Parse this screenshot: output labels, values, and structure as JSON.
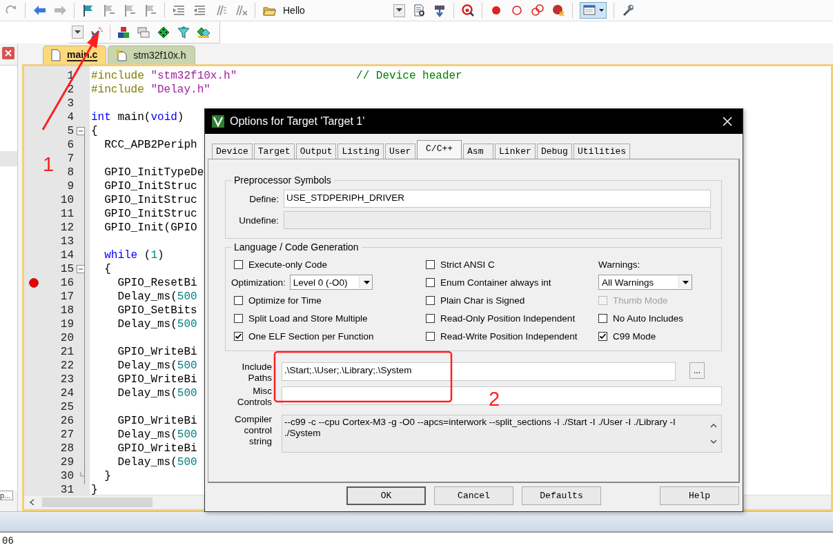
{
  "toolbar": {
    "target_name": "Hello"
  },
  "side_panel": {
    "truncated_label": "p..."
  },
  "editor": {
    "tabs": [
      {
        "label": "main.c",
        "selected": true,
        "kind": "source"
      },
      {
        "label": "stm32f10x.h",
        "selected": false,
        "kind": "header"
      }
    ],
    "lines": [
      {
        "number": "1",
        "breakpoint": false,
        "tokens": [
          {
            "kind": "preproc",
            "text": "#include"
          },
          {
            "kind": "string",
            "text": " \"stm32f10x.h\""
          },
          {
            "kind": "comment",
            "text": "                  // Device header"
          }
        ]
      },
      {
        "number": "2",
        "breakpoint": false,
        "tokens": [
          {
            "kind": "preproc",
            "text": "#include"
          },
          {
            "kind": "string",
            "text": " \"Delay.h\""
          }
        ]
      },
      {
        "number": "3",
        "breakpoint": false
      },
      {
        "number": "4",
        "breakpoint": false,
        "tokens": [
          {
            "kind": "keyword",
            "text": "int"
          },
          {
            "kind": "plain",
            "text": " main("
          },
          {
            "kind": "keyword",
            "text": "void"
          },
          {
            "kind": "plain",
            "text": ")"
          }
        ]
      },
      {
        "number": "5",
        "breakpoint": false,
        "kind": "fold",
        "tokens": [
          {
            "kind": "plain",
            "text": "{"
          }
        ]
      },
      {
        "number": "6",
        "breakpoint": false,
        "tokens": [
          {
            "kind": "plain",
            "text": "  RCC_APB2Periph"
          }
        ]
      },
      {
        "number": "7",
        "breakpoint": false
      },
      {
        "number": "8",
        "breakpoint": false,
        "tokens": [
          {
            "kind": "plain",
            "text": "  GPIO_InitTypeDe"
          }
        ]
      },
      {
        "number": "9",
        "breakpoint": false,
        "tokens": [
          {
            "kind": "plain",
            "text": "  GPIO_InitStruc"
          }
        ]
      },
      {
        "number": "10",
        "breakpoint": false,
        "tokens": [
          {
            "kind": "plain",
            "text": "  GPIO_InitStruc"
          }
        ]
      },
      {
        "number": "11",
        "breakpoint": false,
        "tokens": [
          {
            "kind": "plain",
            "text": "  GPIO_InitStruc"
          }
        ]
      },
      {
        "number": "12",
        "breakpoint": false,
        "tokens": [
          {
            "kind": "plain",
            "text": "  GPIO_Init(GPIO"
          }
        ]
      },
      {
        "number": "13",
        "breakpoint": false
      },
      {
        "number": "14",
        "breakpoint": false,
        "tokens": [
          {
            "kind": "keyword",
            "text": "  while"
          },
          {
            "kind": "plain",
            "text": " ("
          },
          {
            "kind": "number",
            "text": "1"
          },
          {
            "kind": "plain",
            "text": ")"
          }
        ]
      },
      {
        "number": "15",
        "breakpoint": false,
        "kind": "fold",
        "tokens": [
          {
            "kind": "plain",
            "text": "  {"
          }
        ]
      },
      {
        "number": "16",
        "breakpoint": true,
        "tokens": [
          {
            "kind": "plain",
            "text": "    GPIO_ResetBi"
          }
        ]
      },
      {
        "number": "17",
        "breakpoint": false,
        "tokens": [
          {
            "kind": "plain",
            "text": "    Delay_ms("
          },
          {
            "kind": "number",
            "text": "500"
          }
        ]
      },
      {
        "number": "18",
        "breakpoint": false,
        "tokens": [
          {
            "kind": "plain",
            "text": "    GPIO_SetBits"
          }
        ]
      },
      {
        "number": "19",
        "breakpoint": false,
        "tokens": [
          {
            "kind": "plain",
            "text": "    Delay_ms("
          },
          {
            "kind": "number",
            "text": "500"
          }
        ]
      },
      {
        "number": "20",
        "breakpoint": false
      },
      {
        "number": "21",
        "breakpoint": false,
        "tokens": [
          {
            "kind": "plain",
            "text": "    GPIO_WriteBi"
          }
        ]
      },
      {
        "number": "22",
        "breakpoint": false,
        "tokens": [
          {
            "kind": "plain",
            "text": "    Delay_ms("
          },
          {
            "kind": "number",
            "text": "500"
          }
        ]
      },
      {
        "number": "23",
        "breakpoint": false,
        "tokens": [
          {
            "kind": "plain",
            "text": "    GPIO_WriteBi"
          }
        ]
      },
      {
        "number": "24",
        "breakpoint": false,
        "tokens": [
          {
            "kind": "plain",
            "text": "    Delay_ms("
          },
          {
            "kind": "number",
            "text": "500"
          }
        ]
      },
      {
        "number": "25",
        "breakpoint": false
      },
      {
        "number": "26",
        "breakpoint": false,
        "tokens": [
          {
            "kind": "plain",
            "text": "    GPIO_WriteBi"
          }
        ]
      },
      {
        "number": "27",
        "breakpoint": false,
        "tokens": [
          {
            "kind": "plain",
            "text": "    Delay_ms("
          },
          {
            "kind": "number",
            "text": "500"
          }
        ]
      },
      {
        "number": "28",
        "breakpoint": false,
        "tokens": [
          {
            "kind": "plain",
            "text": "    GPIO_WriteBi"
          }
        ]
      },
      {
        "number": "29",
        "breakpoint": false,
        "tokens": [
          {
            "kind": "plain",
            "text": "    Delay_ms("
          },
          {
            "kind": "number",
            "text": "500"
          }
        ]
      },
      {
        "number": "30",
        "breakpoint": false,
        "kind": "close",
        "tokens": [
          {
            "kind": "plain",
            "text": "  }"
          }
        ]
      },
      {
        "number": "31",
        "breakpoint": false,
        "tokens": [
          {
            "kind": "plain",
            "text": "}"
          }
        ]
      }
    ]
  },
  "dialog": {
    "title": "Options for Target 'Target 1'",
    "tabs": [
      {
        "label": "Device",
        "selected": false
      },
      {
        "label": "Target",
        "selected": false
      },
      {
        "label": "Output",
        "selected": false
      },
      {
        "label": "Listing",
        "selected": false
      },
      {
        "label": "User",
        "selected": false
      },
      {
        "label": "C/C++",
        "selected": true
      },
      {
        "label": "Asm",
        "selected": false
      },
      {
        "label": "Linker",
        "selected": false
      },
      {
        "label": "Debug",
        "selected": false
      },
      {
        "label": "Utilities",
        "selected": false
      }
    ],
    "preprocessor": {
      "title": "Preprocessor Symbols",
      "fields": [
        {
          "label": "Define:",
          "value": "USE_STDPERIPH_DRIVER",
          "disabled": false
        },
        {
          "label": "Undefine:",
          "disabled": true
        }
      ]
    },
    "language": {
      "title": "Language / Code Generation",
      "options": [
        {
          "kind": "checkbox",
          "label": "Execute-only Code",
          "checked": false,
          "disabled": false
        },
        {
          "kind": "checkbox",
          "label": "Strict ANSI C",
          "checked": false,
          "disabled": false
        },
        {
          "kind": "label",
          "label": "Warnings:"
        },
        {
          "kind": "select",
          "label": "Optimization:",
          "value": "Level 0 (-O0)"
        },
        {
          "kind": "checkbox",
          "label": "Enum Container always int",
          "checked": false,
          "disabled": false
        },
        {
          "kind": "select",
          "value": "All Warnings"
        },
        {
          "kind": "checkbox",
          "label": "Optimize for Time",
          "checked": false,
          "disabled": false
        },
        {
          "kind": "checkbox",
          "label": "Plain Char is Signed",
          "checked": false,
          "disabled": false
        },
        {
          "kind": "checkbox",
          "label": "Thumb Mode",
          "checked": false,
          "disabled": true
        },
        {
          "kind": "checkbox",
          "label": "Split Load and Store Multiple",
          "checked": false,
          "disabled": false
        },
        {
          "kind": "checkbox",
          "label": "Read-Only Position Independent",
          "checked": false,
          "disabled": false
        },
        {
          "kind": "checkbox",
          "label": "No Auto Includes",
          "checked": false,
          "disabled": false
        },
        {
          "kind": "checkbox",
          "label": "One ELF Section per Function",
          "checked": true,
          "disabled": false
        },
        {
          "kind": "checkbox",
          "label": "Read-Write Position Independent",
          "checked": false,
          "disabled": false
        },
        {
          "kind": "checkbox",
          "label": "C99 Mode",
          "checked": true,
          "disabled": false
        }
      ]
    },
    "fields": [
      {
        "kind": "browse",
        "label": "Include Paths",
        "value": ".\\Start;.\\User;.\\Library;.\\System",
        "button": "...",
        "disabled": false
      },
      {
        "kind": "plain",
        "label": "Misc Controls",
        "disabled": false
      },
      {
        "kind": "multiline",
        "label": "Compiler control string",
        "value": "--c99 -c --cpu Cortex-M3 -g -O0 --apcs=interwork --split_sections -I ./Start -I ./User -I ./Library -I ./System",
        "disabled": true
      }
    ],
    "buttons": [
      {
        "label": "OK",
        "default": true
      },
      {
        "label": "Cancel",
        "default": false
      },
      {
        "label": "Defaults",
        "default": false
      },
      {
        "label": "Help",
        "default": false
      }
    ]
  },
  "annotations": [
    {
      "kind": "arrow",
      "label": "1"
    },
    {
      "kind": "box",
      "label": "2"
    }
  ],
  "output": {
    "lines": [
      "06"
    ]
  }
}
